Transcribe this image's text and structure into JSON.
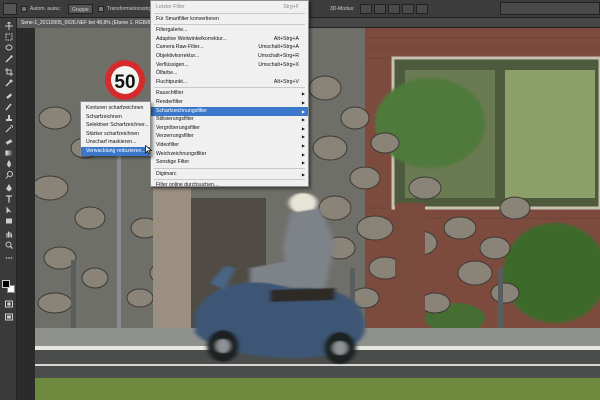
{
  "options_bar": {
    "auto_select_label": "Autom. ausw.:",
    "auto_select_value": "Gruppe",
    "transform_label": "Transformationsstrg.",
    "mode_3d_label": "3D-Modus:"
  },
  "document_tab": {
    "title": "Sene-1_20110905_0626.NEF bei 48,8% (Ebene 1, RGB/8*) *",
    "close_label": "×"
  },
  "filter_menu": {
    "items": [
      {
        "label": "Letzter Filter",
        "shortcut": "Strg+F",
        "disabled": true
      },
      {
        "label": "Für Smartfilter konvertieren"
      },
      {
        "label": "Filtergalerie..."
      },
      {
        "label": "Adaptive Weitwinkelkorrektur...",
        "shortcut": "Alt+Strg+A"
      },
      {
        "label": "Camera Raw-Filter...",
        "shortcut": "Umschalt+Strg+A"
      },
      {
        "label": "Objektivkorrektur...",
        "shortcut": "Umschalt+Strg+R"
      },
      {
        "label": "Verflüssigen...",
        "shortcut": "Umschalt+Strg+X"
      },
      {
        "label": "Ölfarbe..."
      },
      {
        "label": "Fluchtpunkt...",
        "shortcut": "Alt+Strg+V"
      },
      {
        "label": "Rauschfilter",
        "submenu": true
      },
      {
        "label": "Renderfilter",
        "submenu": true
      },
      {
        "label": "Scharfzeichnungsfilter",
        "submenu": true,
        "highlighted": true
      },
      {
        "label": "Stilisierungsfilter",
        "submenu": true
      },
      {
        "label": "Vergröberungsfilter",
        "submenu": true
      },
      {
        "label": "Verzerrungsfilter",
        "submenu": true
      },
      {
        "label": "Videofilter",
        "submenu": true
      },
      {
        "label": "Weichzeichnungsfilter",
        "submenu": true
      },
      {
        "label": "Sonstige Filter",
        "submenu": true
      },
      {
        "label": "Digimarc",
        "submenu": true
      },
      {
        "label": "Filter online durchsuchen..."
      }
    ]
  },
  "sharpen_submenu": {
    "items": [
      {
        "label": "Konturen scharfzeichnen"
      },
      {
        "label": "Scharfzeichnen"
      },
      {
        "label": "Selektiver Scharfzeichner..."
      },
      {
        "label": "Stärker scharfzeichnen"
      },
      {
        "label": "Unscharf maskieren..."
      },
      {
        "label": "Verwacklung reduzieren...",
        "highlighted": true
      }
    ]
  },
  "sign": {
    "text": "50"
  },
  "tools": [
    "move-tool-icon",
    "marquee-tool-icon",
    "lasso-tool-icon",
    "quick-select-tool-icon",
    "crop-tool-icon",
    "eyedropper-tool-icon",
    "healing-brush-tool-icon",
    "brush-tool-icon",
    "clone-stamp-tool-icon",
    "history-brush-tool-icon",
    "eraser-tool-icon",
    "gradient-tool-icon",
    "blur-tool-icon",
    "dodge-tool-icon",
    "pen-tool-icon",
    "type-tool-icon",
    "path-select-tool-icon",
    "shape-tool-icon",
    "hand-tool-icon",
    "zoom-tool-icon"
  ],
  "colors": {
    "foreground": "#000000",
    "background": "#ffffff",
    "menu_highlight": "#3b78c9"
  }
}
